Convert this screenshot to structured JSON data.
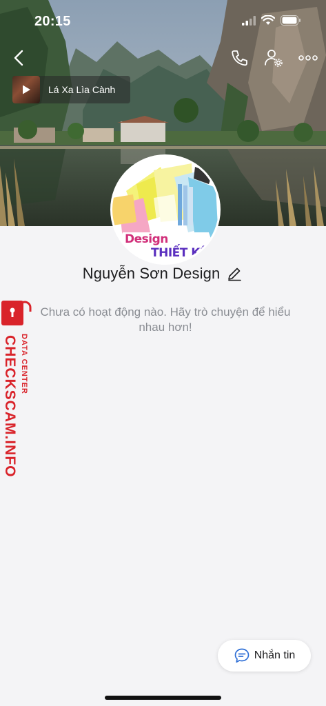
{
  "status_bar": {
    "time": "20:15",
    "icons": [
      "signal-icon",
      "wifi-icon",
      "battery-icon"
    ]
  },
  "nav": {
    "back_icon": "back-chevron-icon",
    "actions": [
      "phone-icon",
      "user-settings-icon",
      "more-icon"
    ]
  },
  "music": {
    "title": "Lá Xa Lìa Cành",
    "icon": "play-icon"
  },
  "avatar": {
    "text_line_1": "Design",
    "text_line_2": "THIẾT KẾ"
  },
  "profile": {
    "name": "Nguyễn Sơn Design",
    "edit_icon": "edit-pencil-icon"
  },
  "empty_state": {
    "message": "Chưa có hoạt động nào. Hãy trò chuyện để hiểu nhau hơn!"
  },
  "watermark": {
    "brand": "CHECKSCAM.INFO",
    "sub": "DATA CENTER"
  },
  "message_button": {
    "label": "Nhắn tin",
    "icon": "chat-bubble-icon"
  },
  "colors": {
    "accent_blue": "#2f6fd6",
    "watermark_red": "#d9232a",
    "background": "#f4f4f6",
    "text_secondary": "#8a8d93"
  }
}
